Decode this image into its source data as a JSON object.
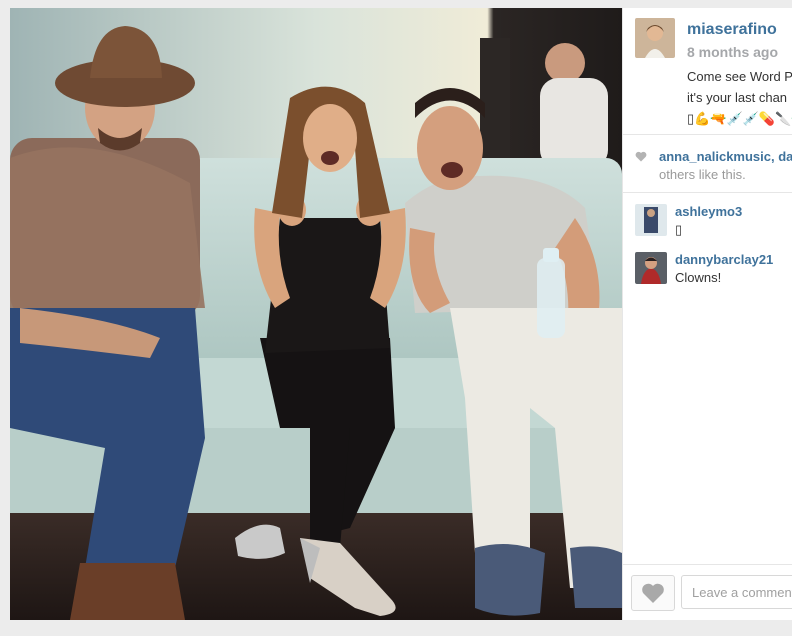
{
  "post": {
    "owner": {
      "username": "miaserafino",
      "time_ago": "8 months ago",
      "caption_lines": [
        "Come see Word P",
        "it's your last chan",
        "▯💪🔫💉💉💊🔪🔫"
      ]
    },
    "likes": {
      "names": "anna_nalickmusic, da",
      "rest": "others like this."
    },
    "comments": [
      {
        "user": "ashleymo3",
        "text": "▯"
      },
      {
        "user": "dannybarclay21",
        "text": "Clowns!"
      }
    ],
    "footer": {
      "comment_placeholder": "Leave a comment..."
    }
  },
  "icons": {
    "like_heart": "heart-icon",
    "likes_heart": "heart-small-icon"
  },
  "colors": {
    "username": "#3f729b",
    "muted": "#a5a7aa",
    "text": "#333333"
  }
}
